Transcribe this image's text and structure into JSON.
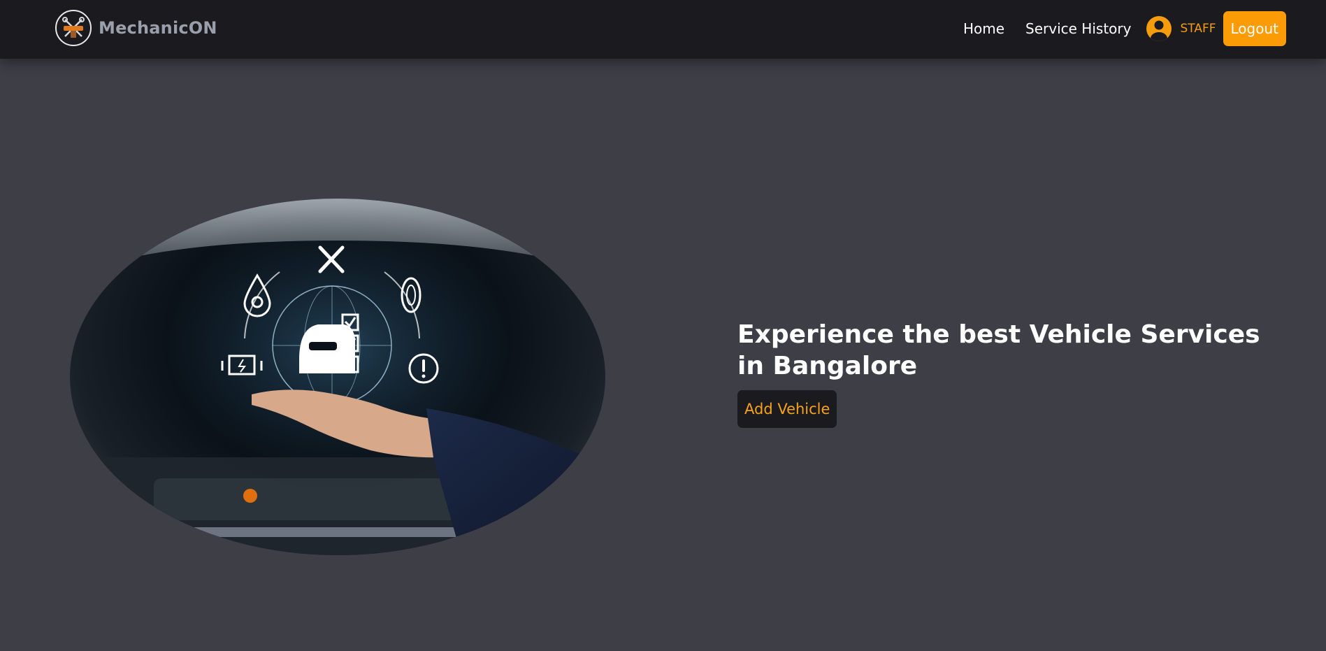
{
  "brand": {
    "name": "MechanicON",
    "logo_icon": "mechanic-badge-icon"
  },
  "nav": {
    "links": [
      {
        "label": "Home"
      },
      {
        "label": "Service History"
      }
    ],
    "user": {
      "icon": "user-circle-icon",
      "role": "STAFF"
    },
    "logout_label": "Logout"
  },
  "hero": {
    "heading": "Experience the best Vehicle Services in Bangalore",
    "add_vehicle_label": "Add Vehicle",
    "image_icons": [
      "wrench-screwdriver-icon",
      "oil-drop-gear-icon",
      "tire-icon",
      "engine-icon",
      "warning-icon",
      "car-checklist-icon",
      "globe-icon"
    ]
  },
  "colors": {
    "accent": "#f59d0c",
    "navbar_bg": "#1b1b1f",
    "page_bg": "#3e3e47",
    "brand_text": "#9aa0ab"
  }
}
